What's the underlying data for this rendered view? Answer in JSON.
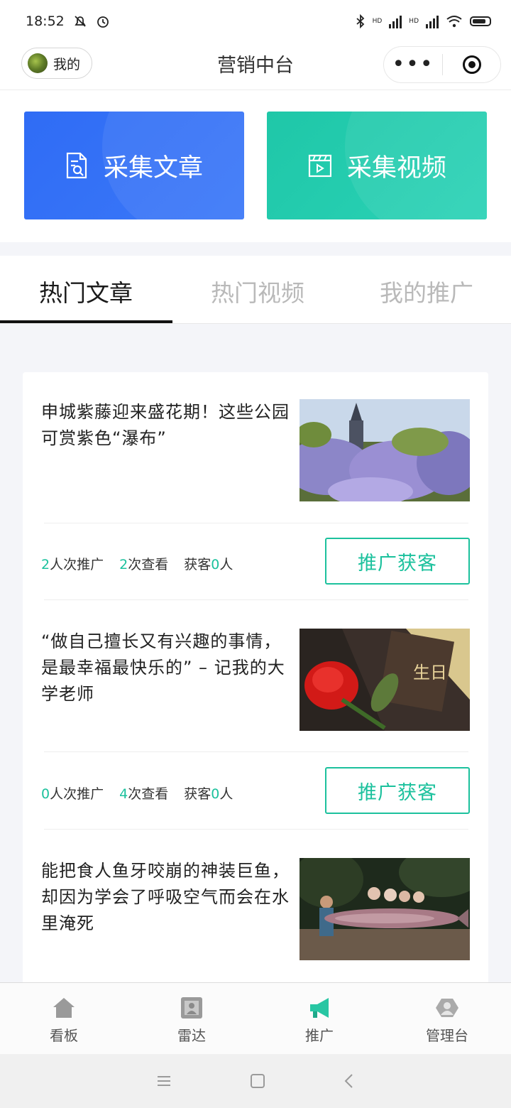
{
  "status_bar": {
    "time": "18:52",
    "network_hd_1": "HD",
    "network_hd_2": "HD"
  },
  "nav": {
    "mine_label": "我的",
    "title": "营销中台"
  },
  "collect": {
    "article_label": "采集文章",
    "video_label": "采集视频",
    "article_color": "#2f6cf5",
    "video_color": "#1fc7a8"
  },
  "tabs": [
    {
      "label": "热门文章",
      "active": true
    },
    {
      "label": "热门视频",
      "active": false
    },
    {
      "label": "我的推广",
      "active": false
    }
  ],
  "articles": [
    {
      "title": "申城紫藤迎来盛花期！这些公园可赏紫色“瀑布”",
      "image": "wisteria-garden-with-tower",
      "promote_count": "2",
      "promote_suffix": "人次推广",
      "view_count": "2",
      "view_suffix": "次查看",
      "guest_prefix": "获客",
      "guest_count": "0",
      "guest_suffix": "人",
      "button": "推广获客"
    },
    {
      "title": "“做自己擅长又有兴趣的事情，是最幸福最快乐的” – 记我的大学老师",
      "image": "red-rose-with-calligraphy",
      "promote_count": "0",
      "promote_suffix": "人次推广",
      "view_count": "4",
      "view_suffix": "次查看",
      "guest_prefix": "获客",
      "guest_count": "0",
      "guest_suffix": "人",
      "button": "推广获客"
    },
    {
      "title": "能把食人鱼牙咬崩的神装巨鱼，却因为学会了呼吸空气而会在水里淹死",
      "image": "people-holding-giant-fish"
    }
  ],
  "tabbar": [
    {
      "label": "看板",
      "icon": "house-icon"
    },
    {
      "label": "雷达",
      "icon": "radar-icon"
    },
    {
      "label": "推广",
      "icon": "megaphone-icon",
      "active": true
    },
    {
      "label": "管理台",
      "icon": "admin-icon"
    }
  ],
  "accent_color": "#1cc19d"
}
